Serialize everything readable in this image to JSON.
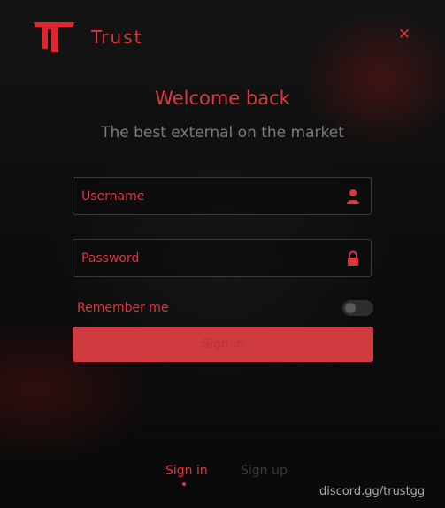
{
  "brand": {
    "name": "Trust",
    "logo_icon": "trust-t-logo",
    "accent_color": "#e0353a"
  },
  "window": {
    "close_icon": "close-x"
  },
  "header": {
    "title": "Welcome back",
    "subtitle": "The best external on the market"
  },
  "form": {
    "username": {
      "placeholder": "Username",
      "value": "",
      "icon": "user-icon"
    },
    "password": {
      "placeholder": "Password",
      "value": "",
      "icon": "lock-icon"
    },
    "remember_me": {
      "label": "Remember me",
      "checked": false
    },
    "submit_label": "Sign in"
  },
  "tabs": [
    {
      "label": "Sign in",
      "active": true
    },
    {
      "label": "Sign up",
      "active": false
    }
  ],
  "footer": {
    "link_text": "discord.gg/trustgg"
  }
}
